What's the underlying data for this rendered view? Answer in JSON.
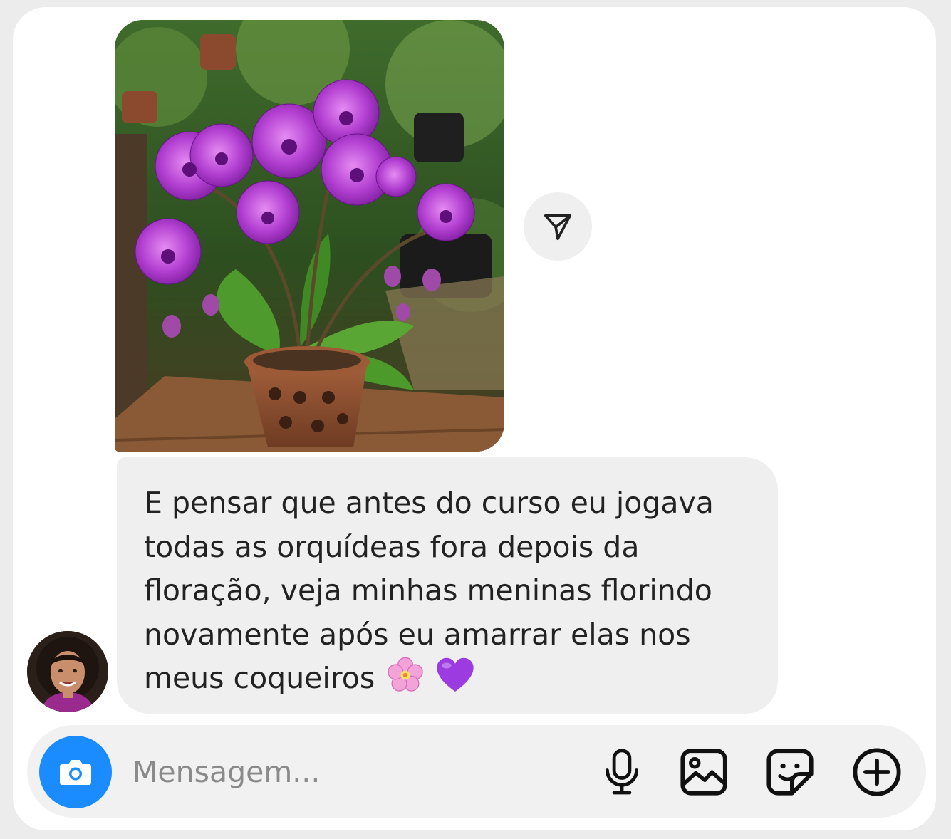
{
  "shared_photo": {
    "alt": "Foto de orquídeas roxas em vaso de barro"
  },
  "share_button": {
    "icon": "paper-plane-icon"
  },
  "message": {
    "text": "E pensar que antes do curso eu jogava todas as orquídeas fora depois da floração, veja minhas meninas florindo novamente após eu amarrar elas nos meus coqueiros",
    "lines": [
      "E pensar que antes do curso eu jogava",
      "todas as orquídeas fora depois da",
      "floração, veja minhas meninas florindo",
      "novamente após eu amarrar elas nos",
      "meus coqueiros"
    ],
    "emojis": [
      "cherry-blossom-icon",
      "purple-heart-icon"
    ]
  },
  "sender": {
    "avatar": "avatar"
  },
  "composer": {
    "placeholder": "Mensagem...",
    "value": "",
    "icons": {
      "camera": "camera-icon",
      "microphone": "microphone-icon",
      "gallery": "image-icon",
      "sticker": "sticker-icon",
      "more": "plus-circle-icon"
    },
    "accent_color": "#1a8cff"
  }
}
